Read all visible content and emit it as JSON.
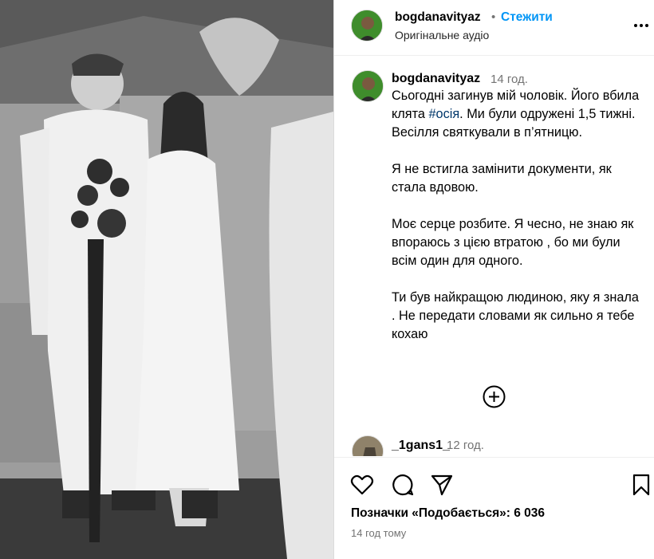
{
  "post": {
    "username": "bogdanavityaz",
    "dot": "•",
    "follow_label": "Стежити",
    "audio_label": "Оригінальне аудіо"
  },
  "caption": {
    "username": "bogdanavityaz",
    "time": "14 год.",
    "lines_p1_before": "Сьогодні загинув мій чоловік. Його вбила клята ",
    "hashtag": "#осія",
    "lines_p1_after": ". Ми були одружені 1,5 тижні. Весілля святкували в п’ятницю.",
    "p2": "Я не встигла замінити документи, як стала вдовою.",
    "p3": "Моє серце розбите. Я чесно, не знаю як впораюсь з цією втратою , бо ми були всім один для одного.",
    "p4": "Ти був найкращою людиною, яку я знала . Не передати словами як сильно я тебе кохаю"
  },
  "comment": {
    "username": "_1gans1_",
    "time": "12 год."
  },
  "likes_label": "Позначки «Подобається»: 6 036",
  "time_ago": "14 год тому",
  "icons": [
    "more-icon",
    "add-comment-icon",
    "heart-icon",
    "comment-icon",
    "share-icon",
    "bookmark-icon"
  ],
  "colors": {
    "link": "#0095f6",
    "hashtag": "#00376b",
    "muted": "#737373"
  }
}
